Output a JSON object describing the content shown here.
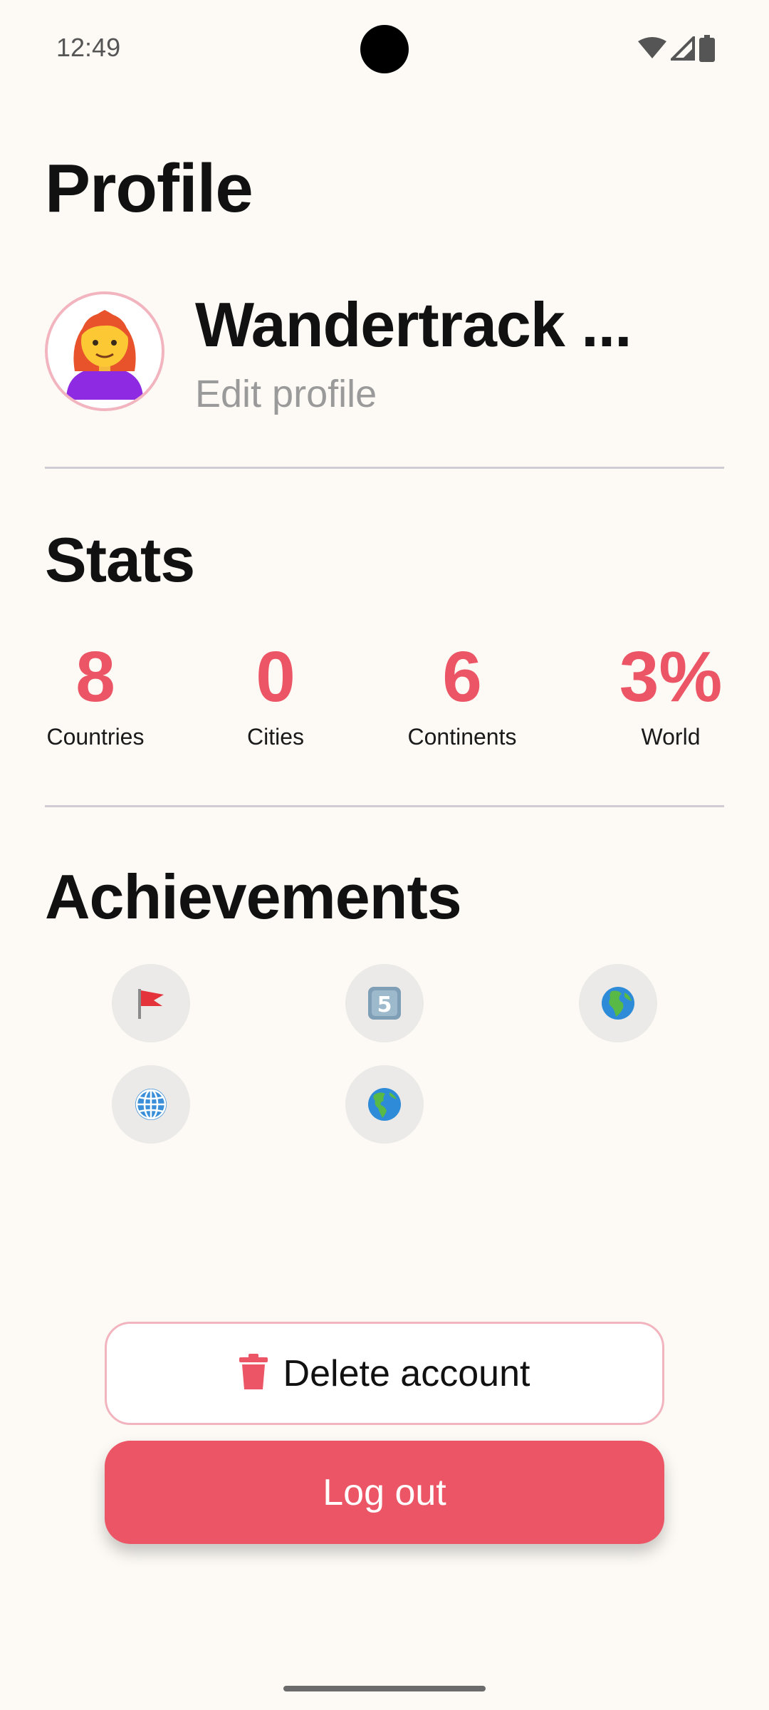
{
  "status_bar": {
    "time": "12:49",
    "icons": [
      "wifi-icon",
      "cellular-signal-icon",
      "battery-icon"
    ]
  },
  "page": {
    "title": "Profile"
  },
  "profile": {
    "avatar_icon": "woman-red-hair-emoji-icon",
    "name": "Wandertrack ...",
    "edit_link": "Edit profile"
  },
  "stats": {
    "title": "Stats",
    "items": [
      {
        "value": "8",
        "label": "Countries"
      },
      {
        "value": "0",
        "label": "Cities"
      },
      {
        "value": "6",
        "label": "Continents"
      },
      {
        "value": "3%",
        "label": "World"
      }
    ]
  },
  "achievements": {
    "title": "Achievements",
    "badges": [
      "red-flag-icon",
      "keycap-five-icon",
      "globe-europe-africa-icon",
      "globe-meridians-icon",
      "globe-americas-icon"
    ]
  },
  "actions": {
    "delete_label": "Delete account",
    "logout_label": "Log out"
  },
  "colors": {
    "accent": "#EC5565",
    "background": "#FDFAF5",
    "accent_border": "#F2B5BF",
    "badge_background": "#EBEAE8"
  }
}
